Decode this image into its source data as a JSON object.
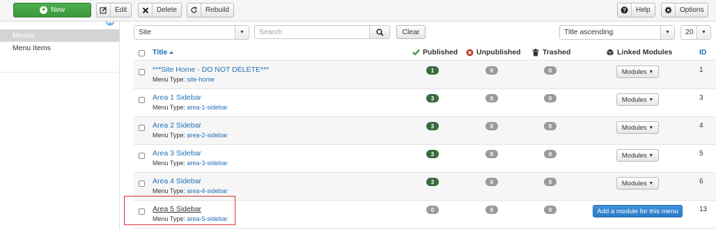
{
  "toolbar": {
    "new_label": "New",
    "edit_label": "Edit",
    "delete_label": "Delete",
    "rebuild_label": "Rebuild",
    "help_label": "Help",
    "options_label": "Options"
  },
  "sidebar": {
    "items": [
      {
        "label": "Menus",
        "active": true
      },
      {
        "label": "Menu Items",
        "active": false
      }
    ]
  },
  "filters": {
    "site_value": "Site",
    "search_placeholder": "Search",
    "clear_label": "Clear",
    "sort_value": "Title ascending",
    "limit_value": "20"
  },
  "table": {
    "headers": {
      "title": "Title",
      "published": "Published",
      "unpublished": "Unpublished",
      "trashed": "Trashed",
      "linked_modules": "Linked Modules",
      "id": "ID"
    },
    "menu_type_label": "Menu Type:",
    "rows": [
      {
        "title": "***Site Home - DO NOT DELETE***",
        "menu_type": "site-home",
        "published": "1",
        "unpublished": "0",
        "trashed": "0",
        "modules": "Modules",
        "id": "1"
      },
      {
        "title": "Area 1 Sidebar",
        "menu_type": "area-1-sidebar",
        "published": "3",
        "unpublished": "0",
        "trashed": "0",
        "modules": "Modules",
        "id": "3"
      },
      {
        "title": "Area 2 Sidebar",
        "menu_type": "area-2-sidebar",
        "published": "3",
        "unpublished": "0",
        "trashed": "0",
        "modules": "Modules",
        "id": "4"
      },
      {
        "title": "Area 3 Sidebar",
        "menu_type": "area-3-sidebar",
        "published": "3",
        "unpublished": "0",
        "trashed": "0",
        "modules": "Modules",
        "id": "5"
      },
      {
        "title": "Area 4 Sidebar",
        "menu_type": "area-4-sidebar",
        "published": "3",
        "unpublished": "0",
        "trashed": "0",
        "modules": "Modules",
        "id": "6"
      },
      {
        "title": "Area 5 Sidebar",
        "menu_type": "area-5-sidebar",
        "published": "0",
        "unpublished": "0",
        "trashed": "0",
        "add_module": "Add a module for this menu",
        "id": "13"
      }
    ]
  },
  "colors": {
    "accent_blue": "#1f6fb5",
    "new_green": "#3c973c",
    "published_badge": "#3d6a3d",
    "zero_badge": "#9a9a9a",
    "highlight_red": "#d93030"
  }
}
